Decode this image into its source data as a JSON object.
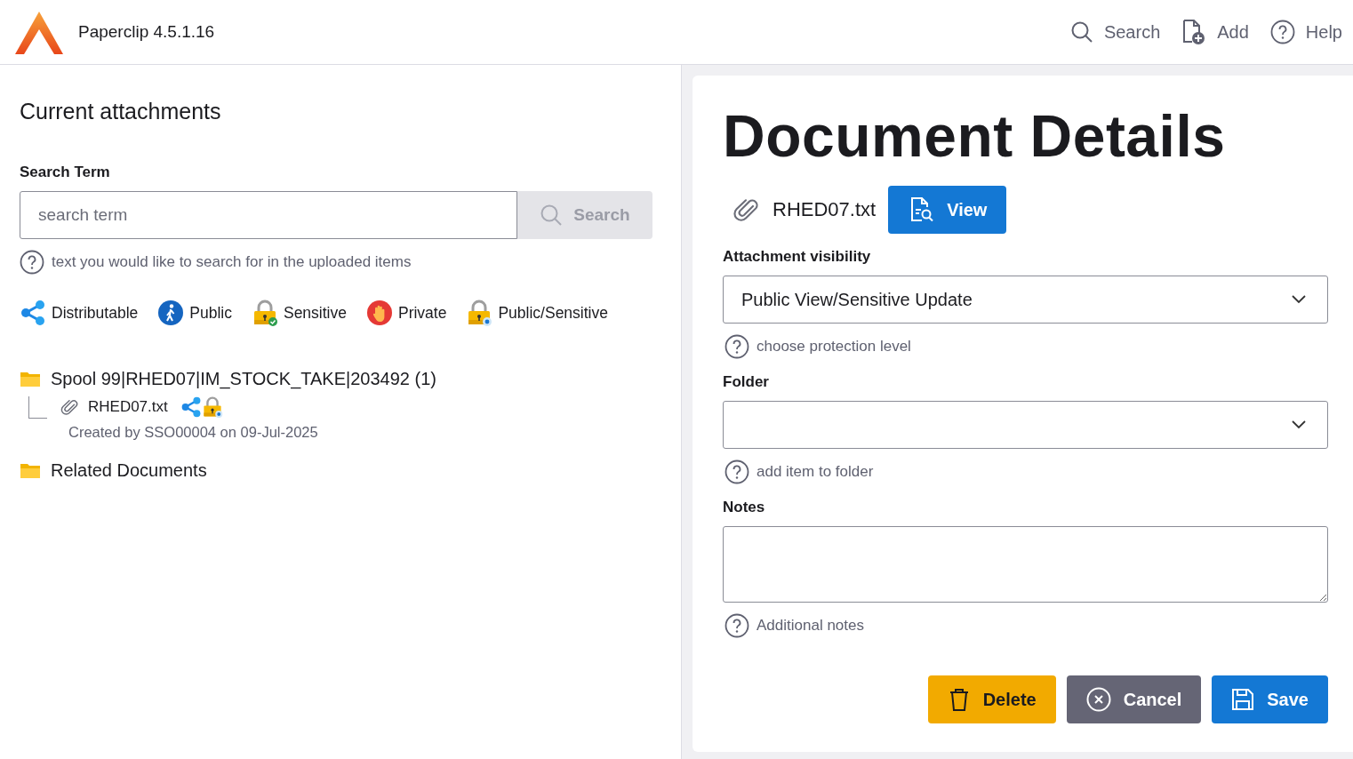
{
  "app": {
    "name": "Paperclip 4.5.1.16"
  },
  "nav": [
    {
      "kind": "search",
      "label": "Search"
    },
    {
      "kind": "add",
      "label": "Add"
    },
    {
      "kind": "help",
      "label": "Help"
    }
  ],
  "attachments": {
    "title": "Current attachments",
    "search": {
      "label": "Search Term",
      "placeholder": "search term",
      "button": "Search",
      "hint": "text you would like to search for in the uploaded items"
    },
    "legend": [
      {
        "kind": "share",
        "label": "Distributable"
      },
      {
        "kind": "walk",
        "label": "Public"
      },
      {
        "kind": "lock-check",
        "label": "Sensitive"
      },
      {
        "kind": "hand",
        "label": "Private"
      },
      {
        "kind": "lock-eye",
        "label": "Public/Sensitive"
      }
    ],
    "tree": [
      {
        "label": "Spool 99|RHED07|IM_STOCK_TAKE|203492 (1)",
        "children": [
          {
            "name": "RHED07.txt",
            "badges": [
              {
                "kind": "share"
              },
              {
                "kind": "lock-eye"
              }
            ],
            "meta": "Created by SSO00004 on 09-Jul-2025"
          }
        ]
      },
      {
        "label": "Related Documents"
      }
    ]
  },
  "details": {
    "title": "Document Details",
    "file": "RHED07.txt",
    "view_button": "View",
    "fields": [
      {
        "kind": "select",
        "label": "Attachment visibility",
        "value": "Public View/Sensitive Update",
        "hint": "choose protection level"
      },
      {
        "kind": "select",
        "label": "Folder",
        "hint": "add item to folder"
      },
      {
        "kind": "textarea",
        "label": "Notes",
        "hint": "Additional notes"
      }
    ],
    "buttons": [
      {
        "kind": "delete",
        "label": "Delete"
      },
      {
        "kind": "cancel",
        "label": "Cancel"
      },
      {
        "kind": "save",
        "label": "Save"
      }
    ]
  }
}
